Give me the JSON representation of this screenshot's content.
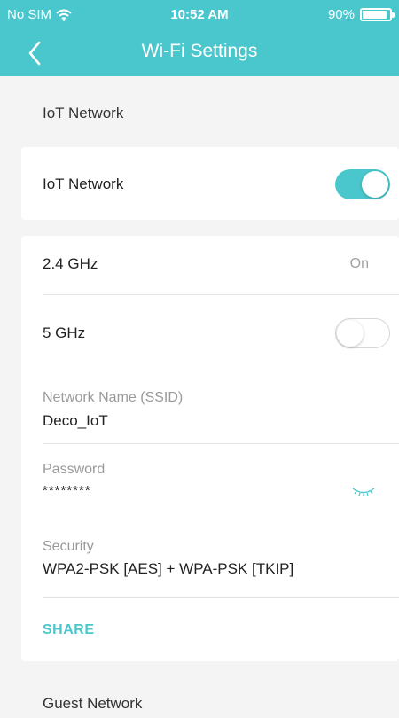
{
  "status_bar": {
    "carrier": "No SIM",
    "wifi_icon": "wifi-icon",
    "time": "10:52 AM",
    "battery_percent": "90%",
    "battery_level": 0.9
  },
  "nav": {
    "title": "Wi-Fi Settings",
    "back_icon": "chevron-left-icon"
  },
  "iot_section": {
    "header": "IoT Network",
    "toggle_label": "IoT Network",
    "toggle_on": true
  },
  "band_card": {
    "band_24_label": "2.4 GHz",
    "band_24_status": "On",
    "band_5_label": "5 GHz",
    "band_5_on": false,
    "ssid_label": "Network Name (SSID)",
    "ssid_value": "Deco_IoT",
    "password_label": "Password",
    "password_value": "********",
    "password_icon": "eye-closed-icon",
    "security_label": "Security",
    "security_value": "WPA2-PSK [AES] + WPA-PSK [TKIP]",
    "share_label": "SHARE"
  },
  "guest_section": {
    "header": "Guest Network"
  },
  "colors": {
    "accent": "#4ac7cc",
    "background": "#f4f4f4"
  }
}
